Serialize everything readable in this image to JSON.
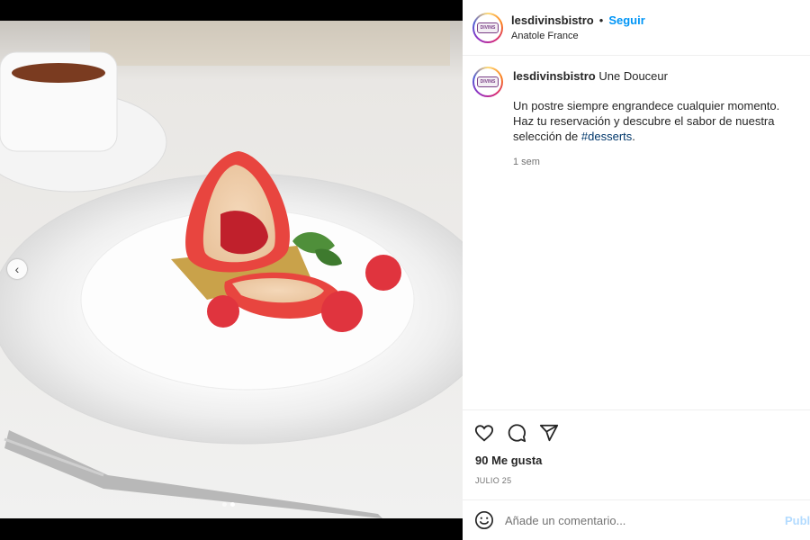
{
  "post": {
    "username": "lesdivinsbistro",
    "separator": "•",
    "follow_label": "Seguir",
    "location": "Anatole France",
    "avatar_logo_text": "DIVINS",
    "caption": {
      "username": "lesdivinsbistro",
      "title": "Une Douceur",
      "text": "Un postre siempre engrandece cualquier momento. Haz tu reservación y descubre el sabor de nuestra selección de",
      "hashtag": "#desserts",
      "trailing": ".",
      "time": "1 sem"
    },
    "likes": "90 Me gusta",
    "date": "JULIO 25",
    "comment": {
      "placeholder": "Añade un comentario...",
      "publish_label": "Publicar"
    }
  },
  "media": {
    "carousel_prev_icon": "chevron-left-icon",
    "carousel_total": 2,
    "carousel_active": 2
  },
  "icons": {
    "like": "heart-icon",
    "comment": "comment-icon",
    "share": "paper-plane-icon",
    "emoji": "smiley-icon"
  },
  "colors": {
    "follow": "#0095f6",
    "hashtag": "#00376b",
    "publish_disabled": "#b3dbff",
    "muted_text": "#737373"
  }
}
